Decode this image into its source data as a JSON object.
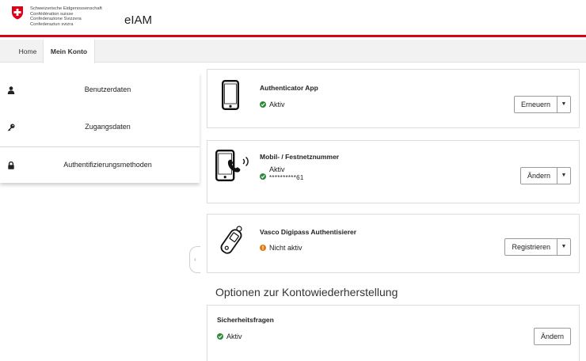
{
  "header": {
    "confederation_lines": [
      "Schweizerische Eidgenossenschaft",
      "Confédération suisse",
      "Confederazione Svizzera",
      "Confederaziun svizra"
    ],
    "app_title": "eIAM",
    "accent": "#dc0018"
  },
  "nav": {
    "tabs": [
      {
        "label": "Home"
      },
      {
        "label": "Mein Konto"
      }
    ]
  },
  "sidebar": {
    "items": [
      {
        "label": "Benutzerdaten",
        "icon": "user-icon"
      },
      {
        "label": "Zugangsdaten",
        "icon": "key-icon"
      },
      {
        "label": "Authentifizierungsmethoden",
        "icon": "lock-icon"
      }
    ]
  },
  "methods": [
    {
      "title": "Authenticator App",
      "status": "Aktiv",
      "status_color": "#2e8b3a",
      "action": "Erneuern",
      "icon": "smartphone-icon"
    },
    {
      "title": "Mobil- / Festnetznummer",
      "status": "Aktiv",
      "detail": "**********61",
      "status_color": "#2e8b3a",
      "action": "Ändern",
      "icon": "phone-call-icon"
    },
    {
      "title": "Vasco Digipass Authentisierer",
      "status": "Nicht aktiv",
      "status_color": "#e07a16",
      "action": "Registrieren",
      "icon": "token-icon"
    }
  ],
  "recovery": {
    "section_title": "Optionen zur Kontowiederherstellung",
    "security_questions": {
      "title": "Sicherheitsfragen",
      "status": "Aktiv",
      "action": "Ändern"
    }
  }
}
